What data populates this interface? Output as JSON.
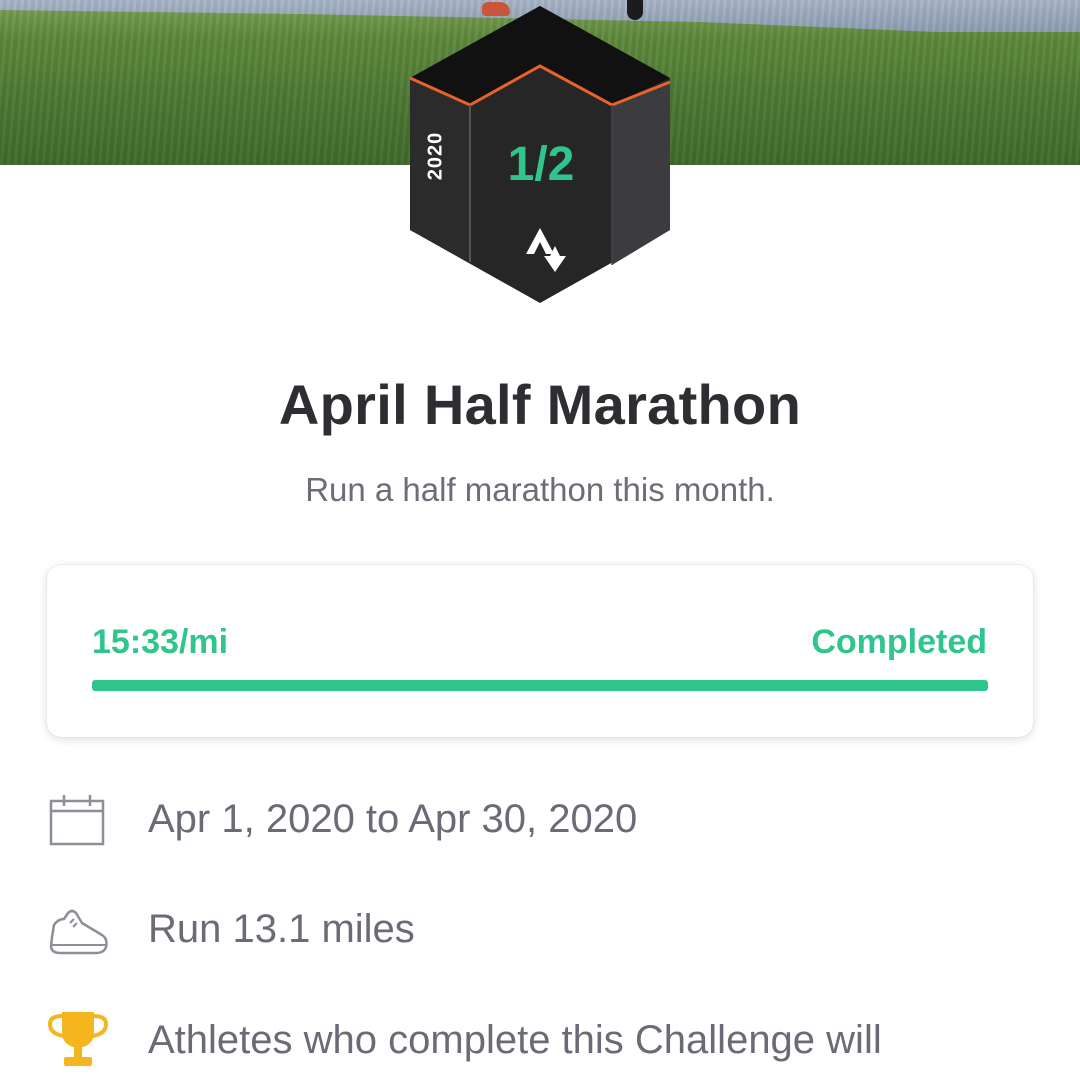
{
  "badge": {
    "year": "2020",
    "fraction": "1/2",
    "logo": "strava-logo-icon"
  },
  "challenge": {
    "title": "April Half Marathon",
    "subtitle": "Run a half marathon this month."
  },
  "progress": {
    "pace": "15:33/mi",
    "status": "Completed",
    "fraction_complete": 1.0
  },
  "details": [
    {
      "icon": "calendar-icon",
      "text": "Apr 1, 2020 to Apr 30, 2020"
    },
    {
      "icon": "shoe-icon",
      "text": "Run 13.1 miles"
    },
    {
      "icon": "trophy-icon",
      "text": "Athletes who complete this Challenge will"
    }
  ],
  "colors": {
    "accent": "#2fc58d",
    "badge_dark": "#262626",
    "badge_orange": "#e8622a",
    "trophy": "#f5b51e"
  }
}
